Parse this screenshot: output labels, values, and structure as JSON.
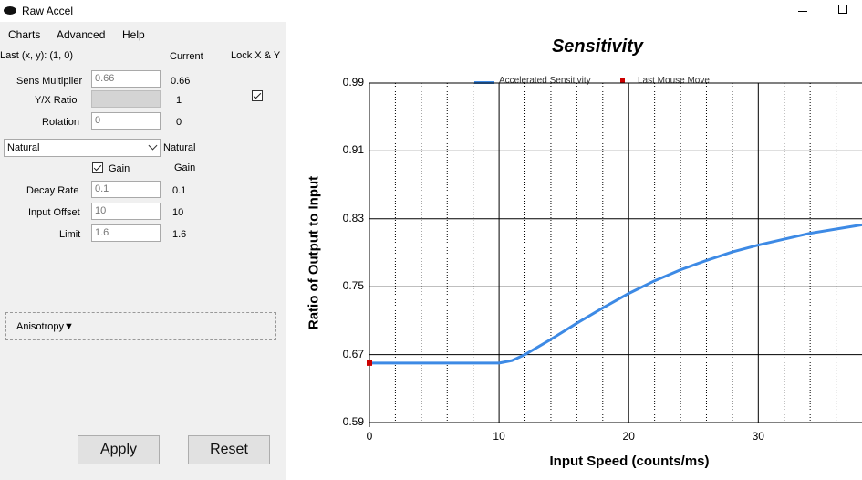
{
  "window": {
    "title": "Raw Accel"
  },
  "menu": {
    "charts": "Charts",
    "advanced": "Advanced",
    "help": "Help"
  },
  "panel": {
    "last_xy": "Last (x, y): (1, 0)",
    "current_header": "Current",
    "lock_xy": "Lock X & Y",
    "lock_xy_checked": true,
    "sens_multiplier": {
      "label": "Sens Multiplier",
      "value": "0.66",
      "current": "0.66"
    },
    "yx_ratio": {
      "label": "Y/X Ratio",
      "value": "",
      "current": "1"
    },
    "rotation": {
      "label": "Rotation",
      "value": "0",
      "current": "0"
    },
    "accel_type": {
      "selected": "Natural",
      "current": "Natural"
    },
    "gain": {
      "label": "Gain",
      "checked": true,
      "current": "Gain"
    },
    "decay_rate": {
      "label": "Decay Rate",
      "value": "0.1",
      "current": "0.1"
    },
    "input_offset": {
      "label": "Input Offset",
      "value": "10",
      "current": "10"
    },
    "limit": {
      "label": "Limit",
      "value": "1.6",
      "current": "1.6"
    },
    "anisotropy": "Anisotropy",
    "apply": "Apply",
    "reset": "Reset"
  },
  "chart_data": {
    "type": "line",
    "title": "Sensitivity",
    "xlabel": "Input Speed (counts/ms)",
    "ylabel": "Ratio of Output to Input",
    "xlim": [
      0,
      38
    ],
    "ylim": [
      0.59,
      0.99
    ],
    "xticks": [
      "0",
      "10",
      "20",
      "30"
    ],
    "yticks": [
      "0.59",
      "0.67",
      "0.75",
      "0.83",
      "0.91",
      "0.99"
    ],
    "grid": true,
    "legend_position": "top",
    "series": [
      {
        "name": "Accelerated Sensitivity",
        "color": "#3d8ae5",
        "x": [
          0,
          10,
          11,
          12,
          14,
          16,
          18,
          20,
          22,
          24,
          26,
          28,
          30,
          32,
          34,
          36,
          38
        ],
        "y": [
          0.66,
          0.66,
          0.663,
          0.67,
          0.688,
          0.707,
          0.725,
          0.742,
          0.757,
          0.77,
          0.781,
          0.791,
          0.799,
          0.806,
          0.813,
          0.818,
          0.823
        ]
      }
    ],
    "points": [
      {
        "name": "Last Mouse Move",
        "color": "#cc0000",
        "x": 0,
        "y": 0.66
      }
    ]
  }
}
